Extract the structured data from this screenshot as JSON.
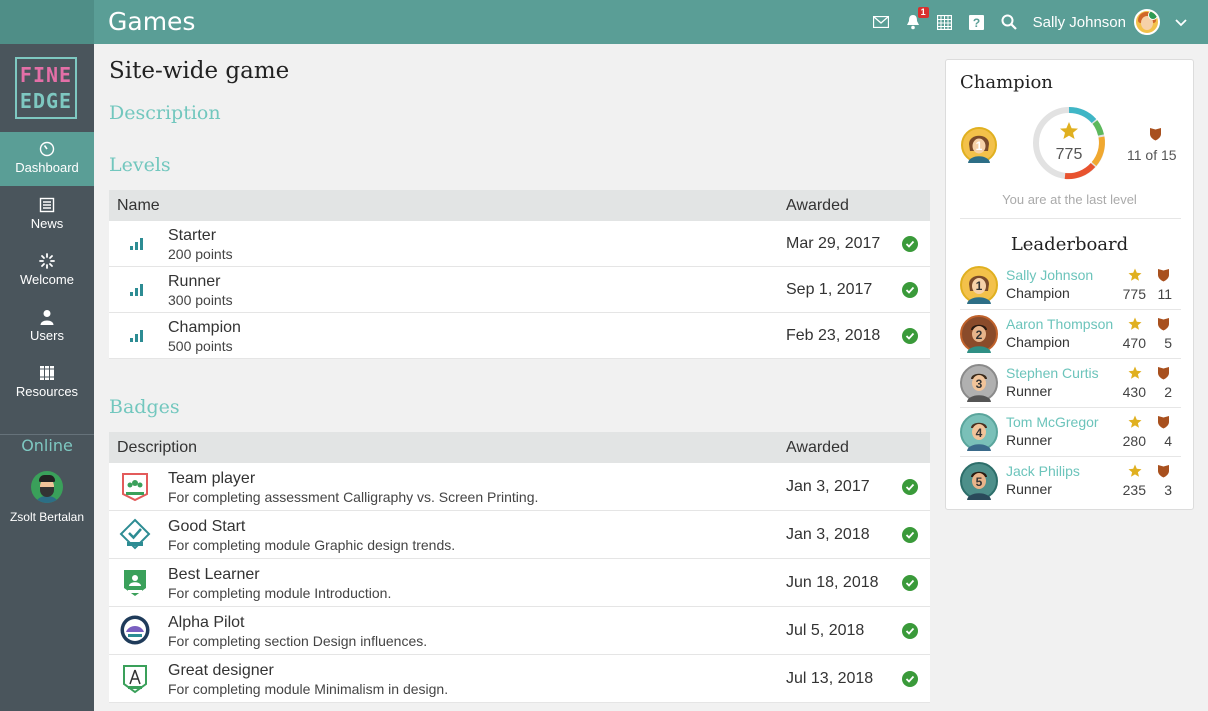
{
  "app": {
    "title": "Games"
  },
  "topbar": {
    "user_name": "Sally Johnson",
    "notification_count": "1"
  },
  "sidebar": {
    "logo_line1": "FINE",
    "logo_line2": "EDGE",
    "items": [
      {
        "label": "Dashboard",
        "icon": "dashboard-icon",
        "active": true
      },
      {
        "label": "News",
        "icon": "news-icon"
      },
      {
        "label": "Welcome",
        "icon": "welcome-icon"
      },
      {
        "label": "Users",
        "icon": "users-icon"
      },
      {
        "label": "Resources",
        "icon": "resources-icon"
      }
    ],
    "online_label": "Online",
    "online_user": "Zsolt Bertalan"
  },
  "main": {
    "title": "Site-wide game",
    "description_heading": "Description",
    "levels_heading": "Levels",
    "levels_columns": {
      "name": "Name",
      "awarded": "Awarded"
    },
    "levels": [
      {
        "name": "Starter",
        "points": "200 points",
        "date": "Mar 29, 2017"
      },
      {
        "name": "Runner",
        "points": "300 points",
        "date": "Sep 1, 2017"
      },
      {
        "name": "Champion",
        "points": "500 points",
        "date": "Feb 23, 2018"
      }
    ],
    "badges_heading": "Badges",
    "badges_columns": {
      "description": "Description",
      "awarded": "Awarded"
    },
    "badges": [
      {
        "name": "Team player",
        "desc": "For completing assessment Calligraphy vs. Screen Printing.",
        "date": "Jan 3, 2017",
        "color": "#e35b5b"
      },
      {
        "name": "Good Start",
        "desc": "For completing module Graphic design trends.",
        "date": "Jan 3, 2018",
        "color": "#2d8c93"
      },
      {
        "name": "Best Learner",
        "desc": "For completing module Introduction.",
        "date": "Jun 18, 2018",
        "color": "#3aa05a"
      },
      {
        "name": "Alpha Pilot",
        "desc": "For completing section Design influences.",
        "date": "Jul 5, 2018",
        "color": "#1f3b5a"
      },
      {
        "name": "Great designer",
        "desc": "For completing module Minimalism in design.",
        "date": "Jul 13, 2018",
        "color": "#3aa05a"
      }
    ]
  },
  "champion_panel": {
    "title": "Champion",
    "rank": "1",
    "score": "775",
    "badges_of": "11 of 15",
    "status": "You are at the last level",
    "leaderboard_title": "Leaderboard",
    "leaderboard": [
      {
        "rank": "1",
        "name": "Sally Johnson",
        "level": "Champion",
        "points": "775",
        "badges": "11",
        "ring": "#e0b020",
        "bg": "#f3c14a"
      },
      {
        "rank": "2",
        "name": "Aaron Thompson",
        "level": "Champion",
        "points": "470",
        "badges": "5",
        "ring": "#c0622b",
        "bg": "#8a4b2a"
      },
      {
        "rank": "3",
        "name": "Stephen Curtis",
        "level": "Runner",
        "points": "430",
        "badges": "2",
        "ring": "#8a8a8a",
        "bg": "#b0b0b0"
      },
      {
        "rank": "4",
        "name": "Tom McGregor",
        "level": "Runner",
        "points": "280",
        "badges": "4",
        "ring": "#5aa59c",
        "bg": "#7ac0b8"
      },
      {
        "rank": "5",
        "name": "Jack Philips",
        "level": "Runner",
        "points": "235",
        "badges": "3",
        "ring": "#2d6e6a",
        "bg": "#4d8f8a"
      }
    ]
  }
}
